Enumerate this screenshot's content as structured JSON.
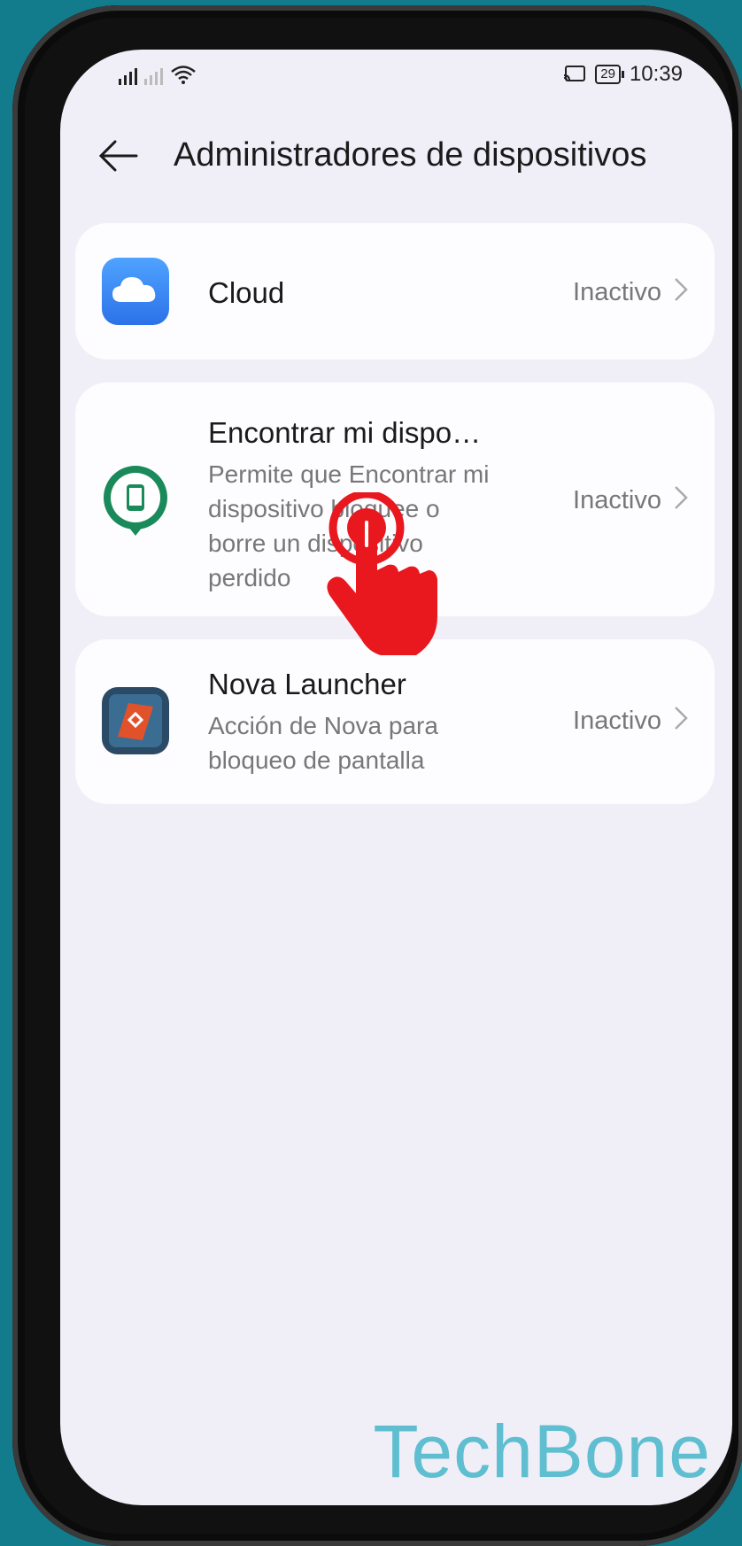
{
  "status_bar": {
    "time": "10:39",
    "battery": "29"
  },
  "header": {
    "title": "Administradores de dispositivos"
  },
  "items": [
    {
      "name": "Cloud",
      "status": "Inactivo",
      "description": ""
    },
    {
      "name": "Encontrar mi dispo…",
      "status": "Inactivo",
      "description": "Permite que Encontrar mi dispositivo bloquee o borre un dispositivo perdido"
    },
    {
      "name": "Nova Launcher",
      "status": "Inactivo",
      "description": "Acción de Nova para bloqueo de pantalla"
    }
  ],
  "watermark": "TechBone",
  "colors": {
    "background": "#137c8c",
    "screen": "#f0eff8",
    "tap_hand": "#e8181e",
    "watermark": "#5fbfd0"
  }
}
